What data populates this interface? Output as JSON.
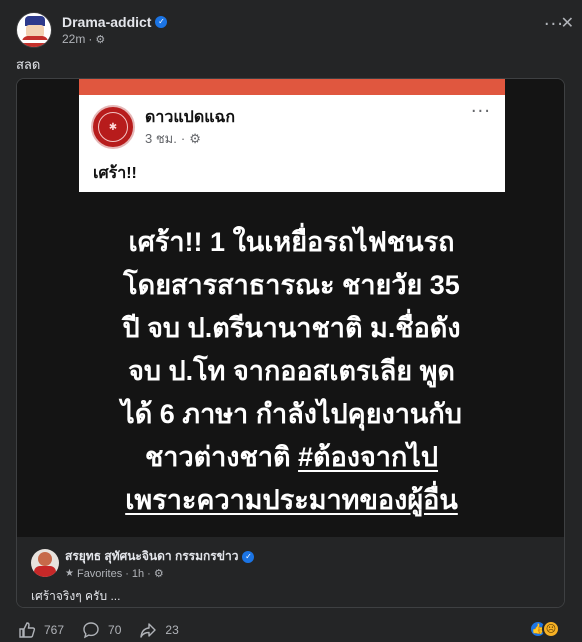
{
  "post": {
    "author": "Drama-addict",
    "time": "22m",
    "separator": "·",
    "caption": "สลด"
  },
  "shared": {
    "page_name": "ดาวแปดแฉก",
    "time": "3 ชม.",
    "separator": "·",
    "short_text": "เศร้า!!",
    "lines": [
      "เศร้า!! 1 ในเหยื่อรถไฟชนรถ",
      "โดยสารสาธารณะ ชายวัย 35",
      "ปี จบ ป.ตรีนานาชาติ ม.ชื่อดัง",
      "จบ ป.โท จากออสเตรเลีย พูด",
      "ได้ 6 ภาษา กำลังไปคุยงานกับ"
    ],
    "line6_prefix": "ชาวต่างชาติ ",
    "line6_hashtag": "#ต้องจากไป",
    "line7_hashtag": "เพราะความประมาทของผู้อื่น"
  },
  "comment": {
    "name": "สรยุทธ สุทัศนะจินดา กรรมกรข่าว",
    "favorites": "Favorites",
    "time": "1h",
    "separator": "·",
    "text": "เศร้าจริงๆ ครับ ..."
  },
  "actions": {
    "likes": "767",
    "comments": "70",
    "shares": "23"
  },
  "icons": {
    "more": "more-icon",
    "close": "close-icon",
    "verified": "verified-badge-icon",
    "privacy": "gear-icon",
    "like": "like-icon",
    "comment": "comment-icon",
    "share": "share-icon"
  },
  "colors": {
    "background": "#242526",
    "card_dark": "#141414",
    "accent_bar": "#e0573f",
    "verified": "#1b74e4"
  }
}
